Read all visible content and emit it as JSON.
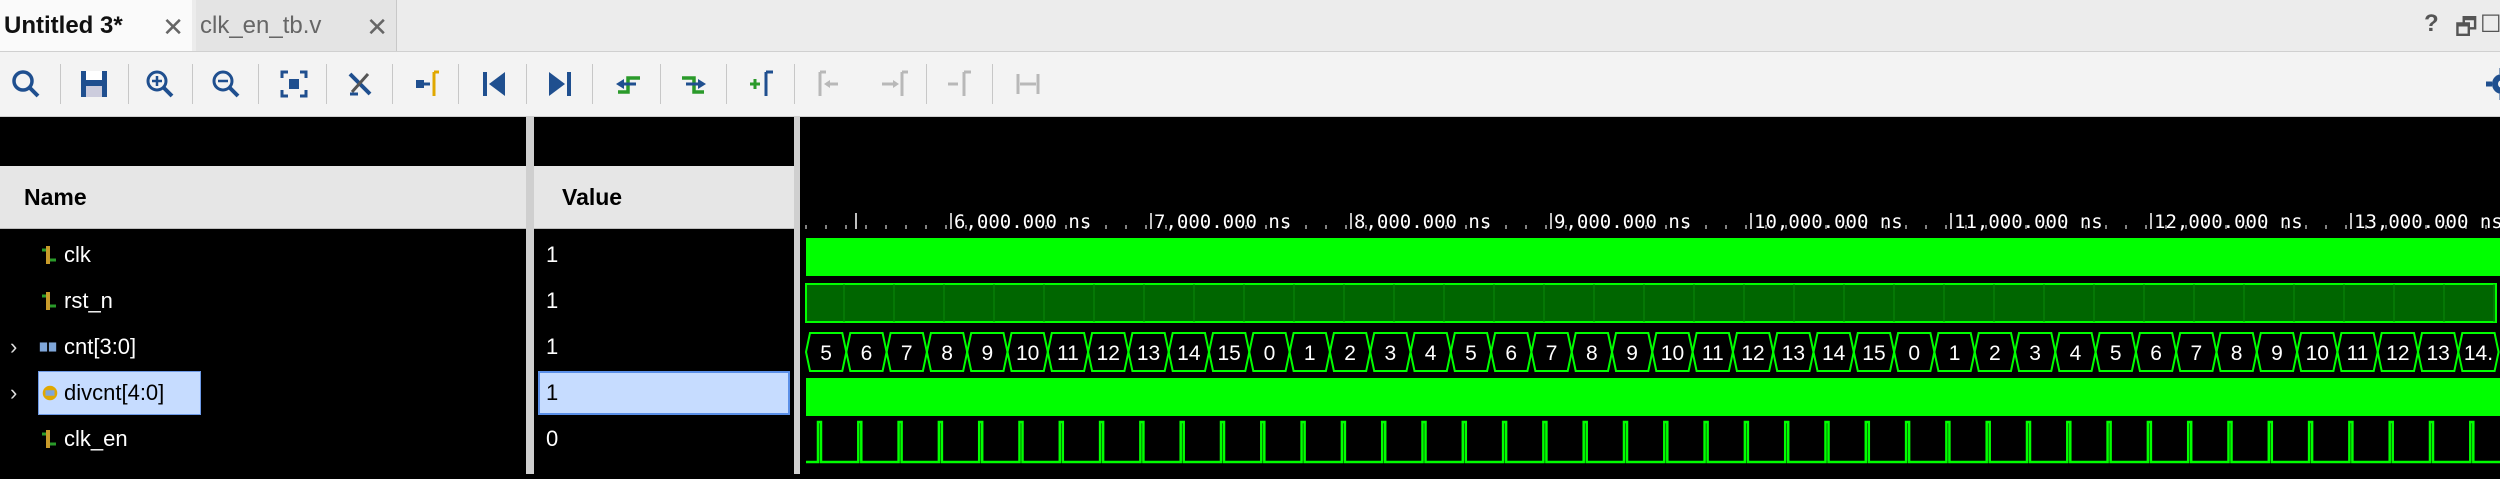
{
  "tabs": [
    {
      "label": "Untitled 3*",
      "close": "✕"
    },
    {
      "label": "clk_en_tb.v",
      "close": "✕"
    }
  ],
  "window_controls": {
    "help": "?",
    "restore": "🗗",
    "maximize": "☐"
  },
  "toolbar": {
    "icons": [
      "search-icon",
      "save-icon",
      "zoom-in-icon",
      "zoom-out-icon",
      "zoom-fit-icon",
      "cursor-snap-icon",
      "goto-cursor-icon",
      "goto-first-icon",
      "goto-last-icon",
      "prev-edge-icon",
      "next-edge-icon",
      "add-marker-icon",
      "prev-marker-icon",
      "next-marker-icon",
      "delete-marker-icon",
      "marker-range-icon",
      "settings-icon"
    ]
  },
  "columns": {
    "name": "Name",
    "value": "Value"
  },
  "signals": [
    {
      "name": "clk",
      "value": "1",
      "type": "bit",
      "expandable": false,
      "selected": false
    },
    {
      "name": "rst_n",
      "value": "1",
      "type": "bit",
      "expandable": false,
      "selected": false
    },
    {
      "name": "cnt[3:0]",
      "value": "1",
      "type": "bus",
      "expandable": true,
      "selected": false
    },
    {
      "name": "divcnt[4:0]",
      "value": "1",
      "type": "bus",
      "expandable": true,
      "selected": true
    },
    {
      "name": "clk_en",
      "value": "0",
      "type": "bit",
      "expandable": false,
      "selected": false
    }
  ],
  "timeline": {
    "labels": [
      "6,000.000 ns",
      "7,000.000 ns",
      "8,000.000 ns",
      "9,000.000 ns",
      "10,000.000 ns",
      "11,000.000 ns",
      "12,000.000 ns",
      "13,000.000 ns"
    ]
  },
  "waves": {
    "cnt_values": [
      "5",
      "6",
      "7",
      "8",
      "9",
      "10",
      "11",
      "12",
      "13",
      "14",
      "15",
      "0",
      "1",
      "2",
      "3",
      "4",
      "5",
      "6",
      "7",
      "8",
      "9",
      "10",
      "11",
      "12",
      "13",
      "14",
      "15",
      "0",
      "1",
      "2",
      "3",
      "4",
      "5",
      "6",
      "7",
      "8",
      "9",
      "10",
      "11",
      "12",
      "13",
      "14."
    ]
  },
  "colors": {
    "wave": "#00ff00",
    "wave_dim": "#006600",
    "bg": "#000000",
    "selection": "#c6dcff"
  }
}
